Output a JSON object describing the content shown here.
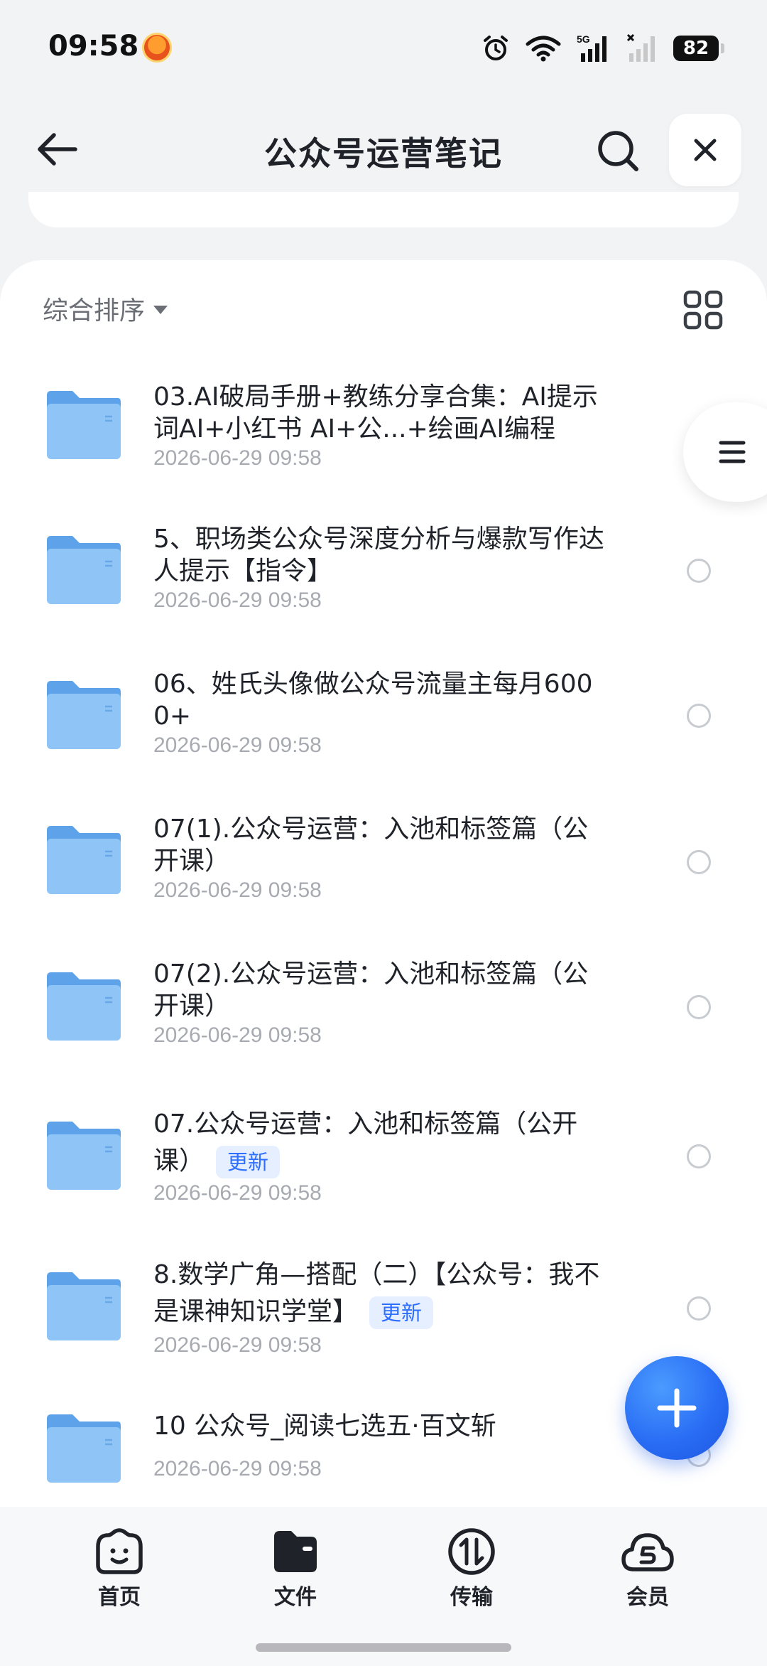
{
  "status_bar": {
    "time": "09:58",
    "battery": "82",
    "network": "5G",
    "icons": [
      "app-notification-icon",
      "alarm-icon",
      "wifi-icon",
      "signal-icon",
      "signal-no-sim-icon",
      "battery-icon"
    ]
  },
  "header": {
    "title": "公众号运营笔记",
    "icons": [
      "back-arrow-icon",
      "search-icon",
      "close-icon"
    ]
  },
  "toolbar": {
    "sort_label": "综合排序",
    "view_toggle_icon": "grid-view-icon"
  },
  "files": [
    {
      "name": "03.AI破局手册+教练分享合集：AI提示词AI+小红书 AI+公...+绘画AI编程",
      "date": "2026-06-29 09:58",
      "tag": ""
    },
    {
      "name": "5、职场类公众号深度分析与爆款写作达人提示【指令】",
      "date": "2026-06-29 09:58",
      "tag": ""
    },
    {
      "name": "06、姓氏头像做公众号流量主每月6000+",
      "date": "2026-06-29 09:58",
      "tag": ""
    },
    {
      "name": "07(1).公众号运营：入池和标签篇（公开课）",
      "date": "2026-06-29 09:58",
      "tag": ""
    },
    {
      "name": "07(2).公众号运营：入池和标签篇（公开课）",
      "date": "2026-06-29 09:58",
      "tag": ""
    },
    {
      "name": "07.公众号运营：入池和标签篇（公开课）",
      "date": "2026-06-29 09:58",
      "tag": "更新"
    },
    {
      "name": "8.数学广角—搭配（二）【公众号：我不是课神知识学堂】",
      "date": "2026-06-29 09:58",
      "tag": "更新"
    },
    {
      "name": "10 公众号_阅读七选五·百文斩",
      "date": "2026-06-29 09:58",
      "tag": ""
    }
  ],
  "floating": {
    "drawer_icon": "menu-icon",
    "fab_icon": "plus-icon"
  },
  "bottom_nav": [
    {
      "label": "首页",
      "icon": "home-smile-icon"
    },
    {
      "label": "文件",
      "icon": "folder-icon"
    },
    {
      "label": "传输",
      "icon": "transfer-icon"
    },
    {
      "label": "会员",
      "icon": "vip-cloud-icon"
    }
  ],
  "colors": {
    "accent": "#2f6fff",
    "folder": "#6fb0f2",
    "background": "#f2f3f5"
  }
}
